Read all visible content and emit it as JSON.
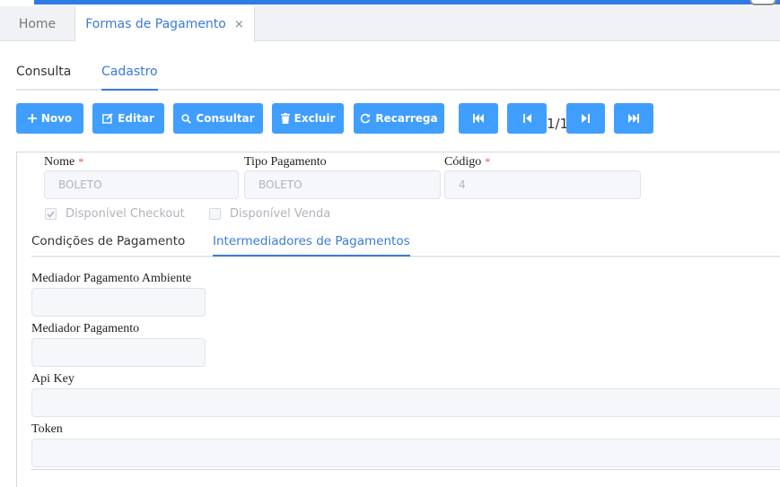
{
  "tabs": {
    "home": "Home",
    "formas": "Formas de Pagamento",
    "close": "×"
  },
  "subtabs": {
    "consulta": "Consulta",
    "cadastro": "Cadastro"
  },
  "toolbar": {
    "novo": "Novo",
    "editar": "Editar",
    "consultar": "Consultar",
    "excluir": "Excluir",
    "recarrega": "Recarrega",
    "page_indicator": "1/1"
  },
  "form": {
    "nome_label": "Nome",
    "nome_value": "BOLETO",
    "tipo_label": "Tipo Pagamento",
    "tipo_value": "BOLETO",
    "codigo_label": "Código",
    "codigo_value": "4",
    "required_mark": "*",
    "checkout_label": "Disponível Checkout",
    "checkout_checked": true,
    "venda_label": "Disponível Venda",
    "venda_checked": false
  },
  "inner_tabs": {
    "condicoes": "Condições de Pagamento",
    "intermediadores": "Intermediadores de Pagamentos"
  },
  "intermediadores": {
    "mediador_ambiente_label": "Mediador Pagamento Ambiente",
    "mediador_ambiente_value": "",
    "mediador_label": "Mediador Pagamento",
    "mediador_value": "",
    "api_key_label": "Api Key",
    "api_key_value": "",
    "token_label": "Token",
    "token_value": ""
  },
  "colors": {
    "accent": "#409eff",
    "active_tab": "#3a7bd5",
    "required": "#e74c3c"
  }
}
